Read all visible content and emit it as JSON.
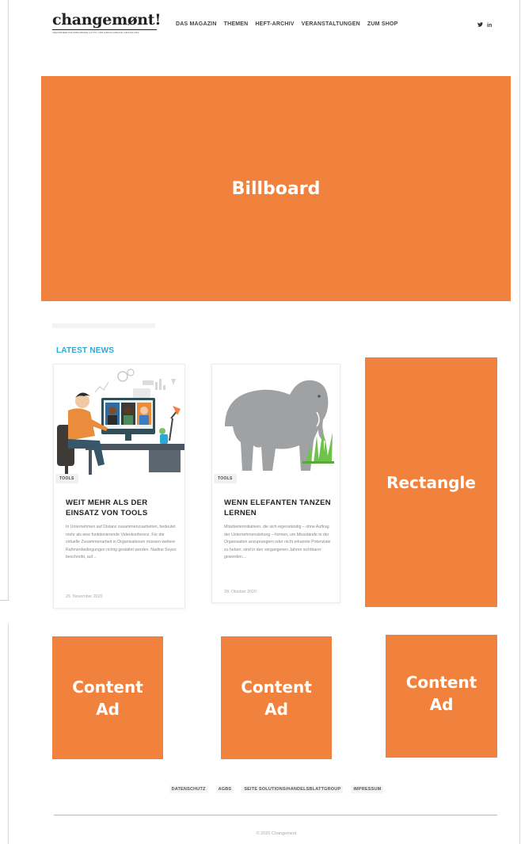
{
  "header": {
    "logo_text": "changemønt!",
    "logo_subtitle": "VERÄNDERUNGSPROZESSE ACTIV UND ERFOLGREICH GESTALTEN",
    "nav": [
      "DAS MAGAZIN",
      "THEMEN",
      "HEFT-ARCHIV",
      "VERANSTALTUNGEN",
      "ZUM SHOP"
    ],
    "social": {
      "twitter": "twitter-icon",
      "linkedin": "linkedin-icon",
      "twitter_glyph": "✔",
      "linkedin_glyph": "in"
    }
  },
  "ads": {
    "billboard": "Billboard",
    "rectangle": "Rectangle",
    "content_ad": "Content Ad",
    "color": "#f0823d"
  },
  "latest_news": {
    "title": "LATEST NEWS",
    "title_color": "#2aa8d8",
    "articles": [
      {
        "tag": "TOOLS",
        "title": "WEIT MEHR ALS DER EINSATZ VON TOOLS",
        "excerpt": "In Unternehmen auf Distanz zusammenzuarbeiten, bedeutet mehr als eine funktionierende Videokonferenz. Für die virtuelle Zusammenarbeit in Organisationen müssen weitere Rahmenbedingungen richtig gestaltet werden. Nadine Soyez beschreibt, auf...",
        "date": "26. November 2020"
      },
      {
        "tag": "TOOLS",
        "title": "WENN ELEFANTEN TANZEN LERNEN",
        "excerpt": "Mitarbeiterinitiativen, die sich eigenständig – ohne Auftrag der Unternehmensleitung – formen, um Missstände in der Organisation anzuprangern oder nicht erkannte Potenziale zu heben, sind in den vergangenen Jahren sichtbarer geworden....",
        "date": "28. Oktober 2020"
      }
    ]
  },
  "footer": {
    "links": [
      "DATENSCHUTZ",
      "AGBS",
      "SEITE SOLUTIONS/HANDELSBLATTGROUP",
      "IMPRESSUM"
    ],
    "copyright": "© 2020 Changement"
  }
}
